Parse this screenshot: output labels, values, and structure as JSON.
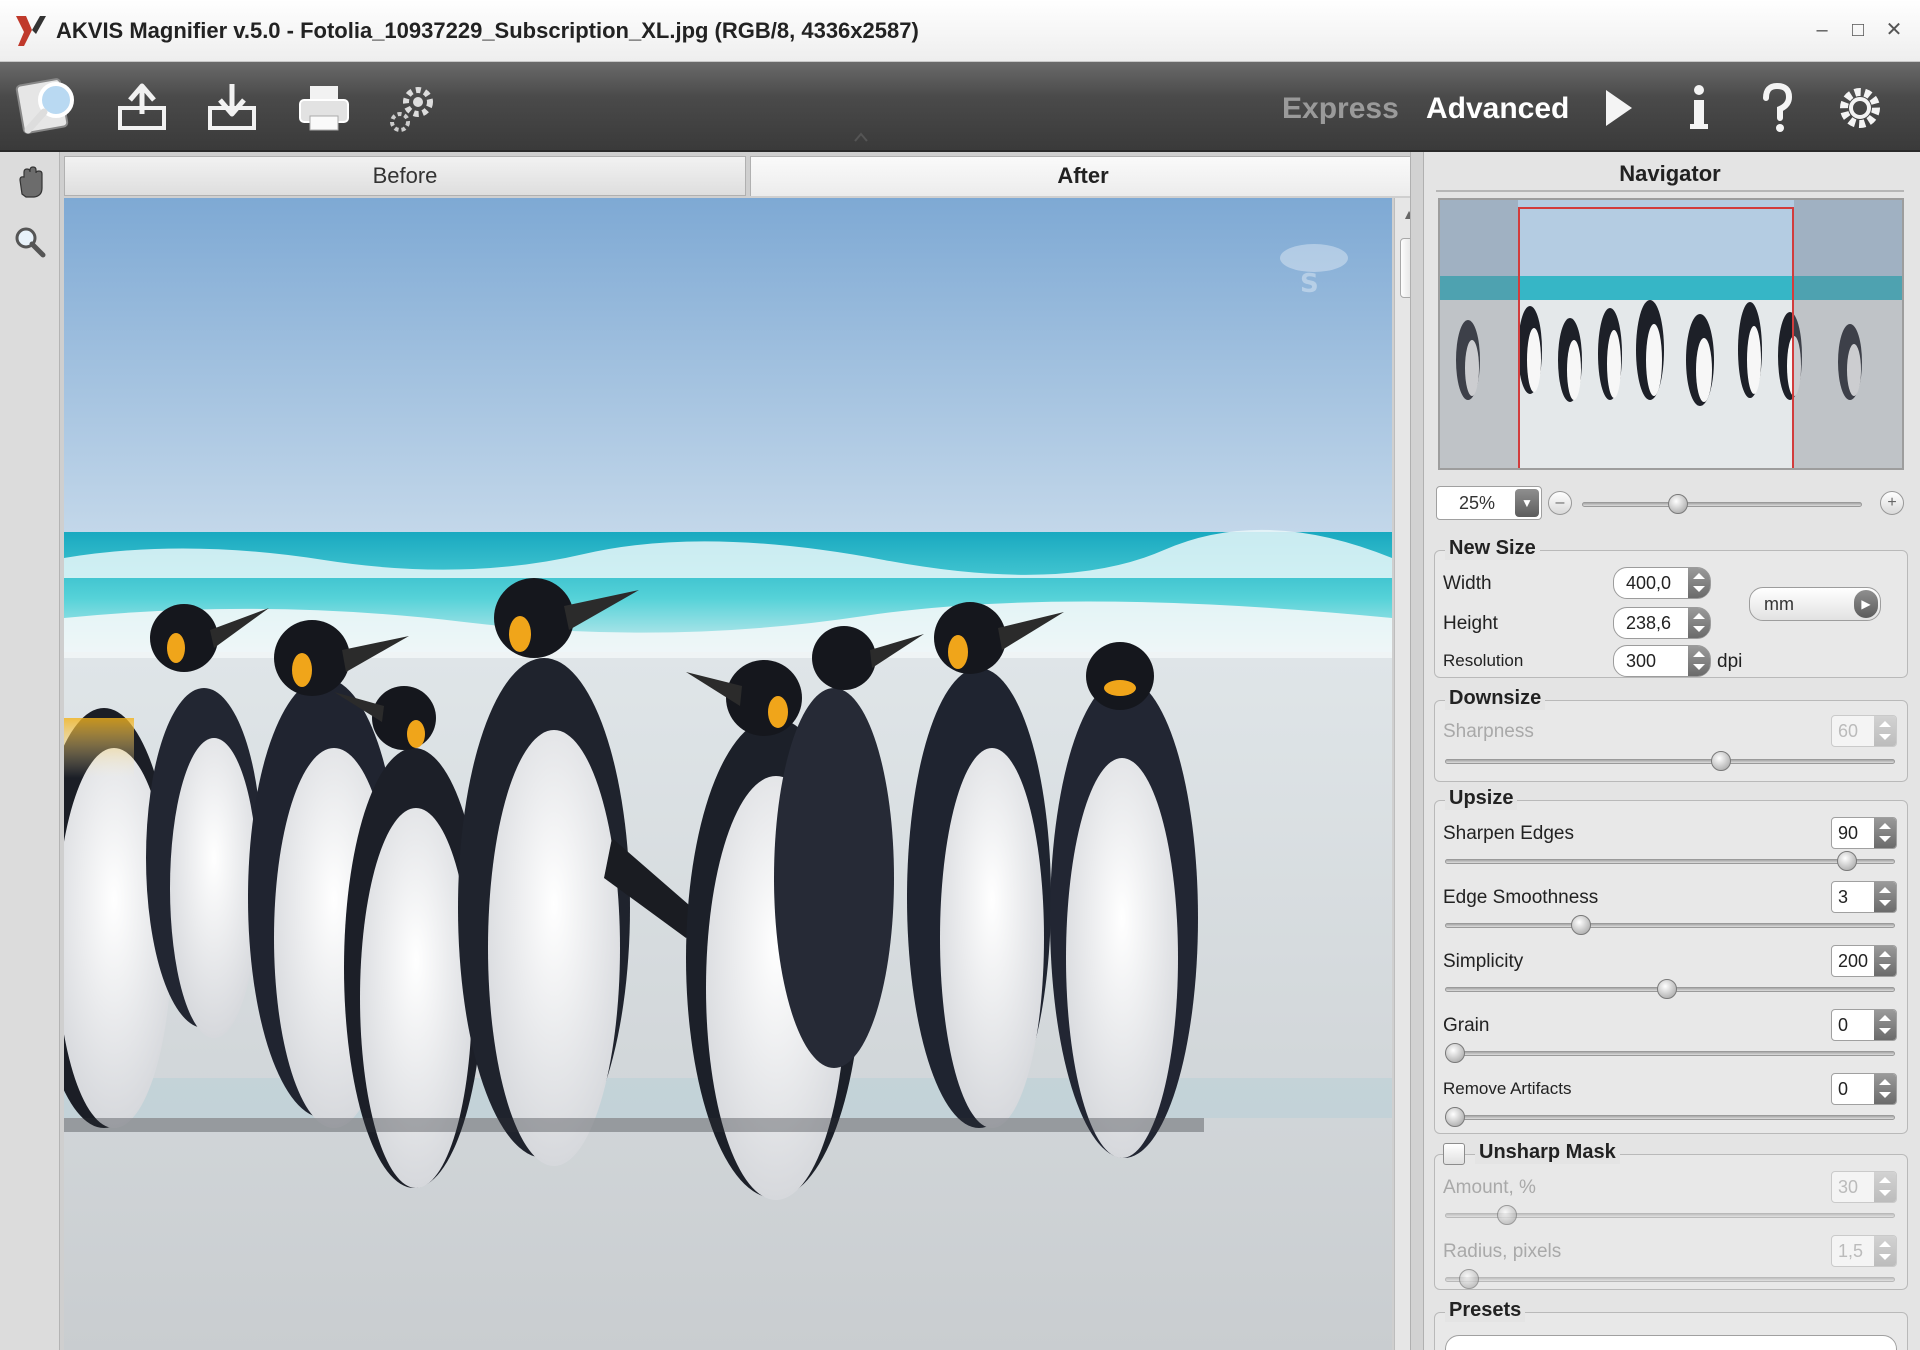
{
  "window": {
    "title": "AKVIS Magnifier v.5.0 - Fotolia_10937229_Subscription_XL.jpg (RGB/8, 4336x2587)",
    "controls": [
      "–",
      "□",
      "✕"
    ]
  },
  "toolbar": {
    "icons": [
      "app-logo-icon",
      "open-image-icon",
      "save-image-icon",
      "print-icon",
      "batch-processing-icon"
    ],
    "mode_express": "Express",
    "mode_advanced": "Advanced",
    "right_icons": [
      "run-icon",
      "info-icon",
      "help-icon",
      "preferences-icon"
    ],
    "active_mode": "Advanced"
  },
  "tools": [
    "hand-tool-icon",
    "zoom-tool-icon"
  ],
  "tabs": {
    "before": "Before",
    "after": "After",
    "active": "After"
  },
  "navigator": {
    "title": "Navigator",
    "zoom": "25%"
  },
  "new_size": {
    "title": "New Size",
    "width_label": "Width",
    "width_value": "400,0",
    "height_label": "Height",
    "height_value": "238,6",
    "resolution_label": "Resolution",
    "resolution_value": "300",
    "resolution_unit": "dpi",
    "units": "mm"
  },
  "downsize": {
    "title": "Downsize",
    "sharpness_label": "Sharpness",
    "sharpness_value": "60",
    "sharpness_level": 0.6
  },
  "upsize": {
    "title": "Upsize",
    "params": [
      {
        "label": "Sharpen Edges",
        "value": "90",
        "level": 0.9
      },
      {
        "label": "Edge Smoothness",
        "value": "3",
        "level": 0.3
      },
      {
        "label": "Simplicity",
        "value": "200",
        "level": 0.5
      },
      {
        "label": "Grain",
        "value": "0",
        "level": 0.0
      },
      {
        "label": "Remove Artifacts",
        "value": "0",
        "level": 0.0
      }
    ]
  },
  "unsharp_mask": {
    "title": "Unsharp Mask",
    "checked": false,
    "amount_label": "Amount, %",
    "amount_value": "30",
    "amount_level": 0.12,
    "radius_label": "Radius, pixels",
    "radius_value": "1,5",
    "radius_level": 0.04
  },
  "presets": {
    "title": "Presets"
  },
  "colors": {
    "toolbar_dark": "#3a3a3a",
    "mode_inactive": "#9a9a9a",
    "mode_active": "#ffffff",
    "navigator_frame": "#d23c3c"
  }
}
